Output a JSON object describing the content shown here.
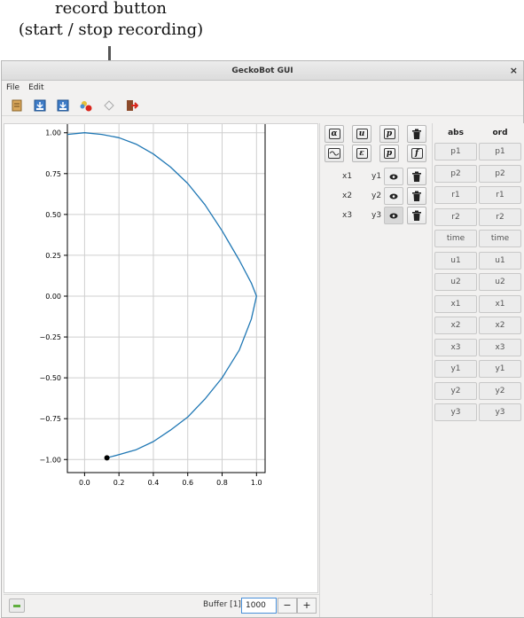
{
  "annotation": {
    "line1": "record button",
    "line2": "(start / stop recording)"
  },
  "window": {
    "title": "GeckoBot GUI",
    "close_glyph": "×"
  },
  "menu": [
    {
      "label": "File"
    },
    {
      "label": "Edit"
    }
  ],
  "toolbar": {
    "icons": [
      "document-icon",
      "import-icon",
      "export-icon",
      "palette-icon",
      "record-icon",
      "exit-icon"
    ]
  },
  "plot": {
    "curve_color": "#1f77b4",
    "marker_color": "#000000"
  },
  "chart_data": {
    "type": "line",
    "title": "",
    "xlabel": "",
    "ylabel": "",
    "xlim": [
      -0.1,
      1.05
    ],
    "ylim": [
      -1.08,
      1.08
    ],
    "xticks": [
      "0.0",
      "0.2",
      "0.4",
      "0.6",
      "0.8",
      "1.0"
    ],
    "yticks": [
      "1.00",
      "0.75",
      "0.50",
      "0.25",
      "0.00",
      "−0.25",
      "−0.50",
      "−0.75",
      "−1.00"
    ],
    "grid": true,
    "series": [
      {
        "x": [
          -0.1,
          0.0,
          0.1,
          0.2,
          0.3,
          0.4,
          0.5,
          0.6,
          0.7,
          0.8,
          0.9,
          0.97,
          1.0,
          0.97,
          0.9,
          0.8,
          0.7,
          0.6,
          0.5,
          0.4,
          0.3,
          0.2,
          0.13
        ],
        "y": [
          0.99,
          1.0,
          0.99,
          0.97,
          0.93,
          0.87,
          0.79,
          0.69,
          0.56,
          0.4,
          0.22,
          0.08,
          0.0,
          -0.14,
          -0.33,
          -0.5,
          -0.63,
          -0.74,
          -0.82,
          -0.89,
          -0.94,
          -0.97,
          -0.99
        ]
      }
    ],
    "marker": {
      "x": 0.13,
      "y": -0.99
    }
  },
  "bottom": {
    "buffer_label": "Buffer [1]:",
    "buffer_value": "1000",
    "minus": "−",
    "plus": "+"
  },
  "middle": {
    "func_buttons": [
      "α",
      "u",
      "p",
      "",
      "",
      "ε",
      "p",
      "f"
    ],
    "rows": [
      {
        "x": "x1",
        "y": "y1",
        "eye_active": false
      },
      {
        "x": "x2",
        "y": "y2",
        "eye_active": false
      },
      {
        "x": "x3",
        "y": "y3",
        "eye_active": true
      }
    ]
  },
  "right": {
    "abs_header": "abs",
    "ord_header": "ord",
    "items": [
      "p1",
      "p2",
      "r1",
      "r2",
      "time",
      "u1",
      "u2",
      "x1",
      "x2",
      "x3",
      "y1",
      "y2",
      "y3"
    ]
  }
}
